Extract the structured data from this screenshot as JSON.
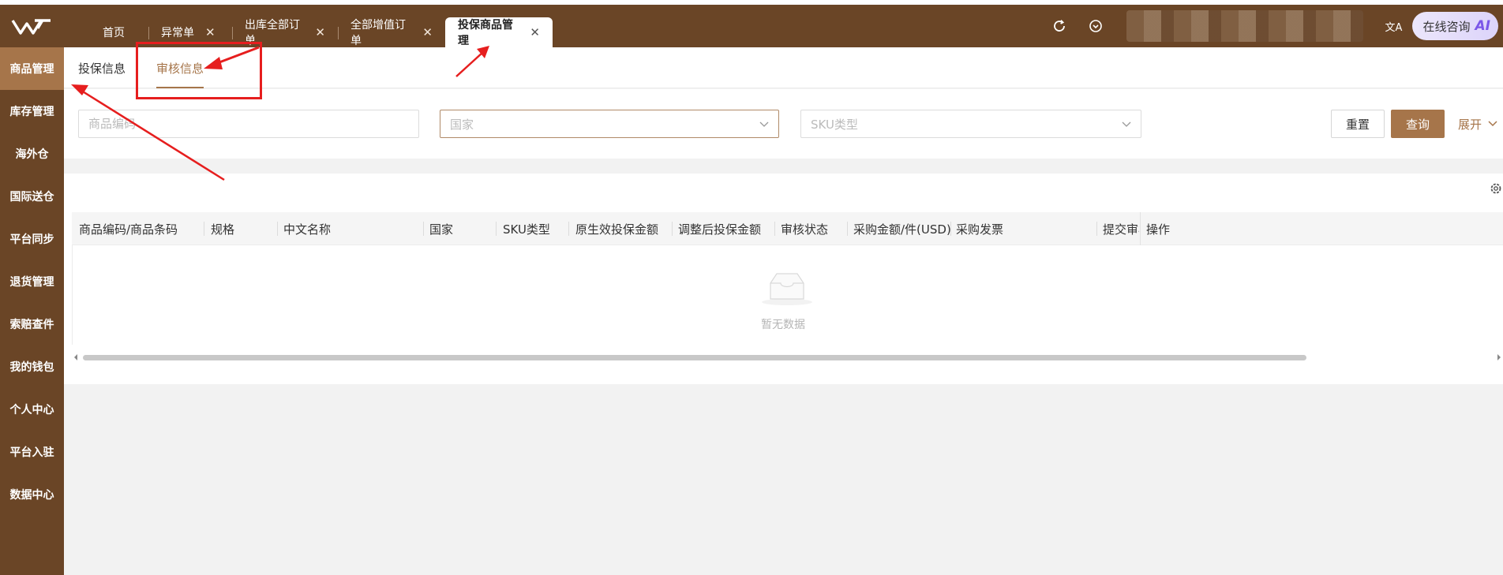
{
  "header": {
    "tabs": [
      {
        "label": "首页",
        "closable": false
      },
      {
        "label": "异常单",
        "closable": true
      },
      {
        "label": "出库全部订单",
        "closable": true
      },
      {
        "label": "全部增值订单",
        "closable": true
      },
      {
        "label": "投保商品管理",
        "closable": true,
        "active": true
      }
    ],
    "close_glyph": "✕",
    "ai_button": {
      "label": "在线咨询",
      "tag": "AI"
    },
    "translate_glyph": "文A"
  },
  "sidebar": {
    "items": [
      {
        "label": "商品管理",
        "active": true
      },
      {
        "label": "库存管理"
      },
      {
        "label": "海外仓"
      },
      {
        "label": "国际送仓"
      },
      {
        "label": "平台同步"
      },
      {
        "label": "退货管理"
      },
      {
        "label": "索赔查件"
      },
      {
        "label": "我的钱包"
      },
      {
        "label": "个人中心"
      },
      {
        "label": "平台入驻"
      },
      {
        "label": "数据中心"
      }
    ]
  },
  "subtabs": [
    {
      "label": "投保信息"
    },
    {
      "label": "审核信息",
      "active": true
    }
  ],
  "filters": {
    "product_code_placeholder": "商品编码",
    "country_placeholder": "国家",
    "sku_type_placeholder": "SKU类型",
    "reset_label": "重置",
    "search_label": "查询",
    "expand_label": "展开"
  },
  "table": {
    "columns": [
      "商品编码/商品条码",
      "规格",
      "中文名称",
      "国家",
      "SKU类型",
      "原生效投保金额",
      "调整后投保金额",
      "审核状态",
      "采购金额/件(USD)",
      "采购发票",
      "提交审核",
      "操作"
    ],
    "empty_text": "暂无数据"
  },
  "colors": {
    "brand_dark": "#6a4526",
    "brand_accent": "#a6754a",
    "annotation_red": "#e61e1e",
    "ai_purple": "#7b57e8"
  }
}
